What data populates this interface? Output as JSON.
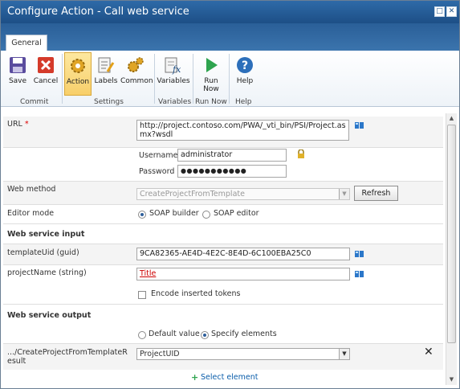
{
  "window": {
    "title": "Configure Action - Call web service"
  },
  "ribbon": {
    "tab": "General",
    "buttons": {
      "save": "Save",
      "cancel": "Cancel",
      "action": "Action",
      "labels": "Labels",
      "common": "Common",
      "variables": "Variables",
      "run_now": "Run Now",
      "help": "Help"
    },
    "groups": {
      "commit": "Commit",
      "settings": "Settings",
      "variables": "Variables",
      "run_now": "Run Now",
      "help": "Help"
    }
  },
  "form": {
    "url_label": "URL",
    "url_required": "*",
    "url_value": "http://project.contoso.com/PWA/_vti_bin/PSI/Project.asmx?wsdl",
    "username_label": "Username",
    "username_value": "administrator",
    "password_label": "Password",
    "password_value": "●●●●●●●●●●●",
    "web_method_label": "Web method",
    "web_method_value": "CreateProjectFromTemplate",
    "refresh_label": "Refresh",
    "editor_mode_label": "Editor mode",
    "soap_builder": "SOAP builder",
    "soap_editor": "SOAP editor",
    "ws_input_heading": "Web service input",
    "template_uid_label": "templateUid (guid)",
    "template_uid_value": "9CA82365-AE4D-4E2C-8E4D-6C100EBA25C0",
    "project_name_label": "projectName (string)",
    "project_name_value": "Title",
    "encode_tokens_label": "Encode inserted tokens",
    "ws_output_heading": "Web service output",
    "default_value": "Default value",
    "specify_elements": "Specify elements",
    "result_label": ".../CreateProjectFromTemplateResult",
    "result_value": "ProjectUID",
    "select_element": "Select element"
  }
}
